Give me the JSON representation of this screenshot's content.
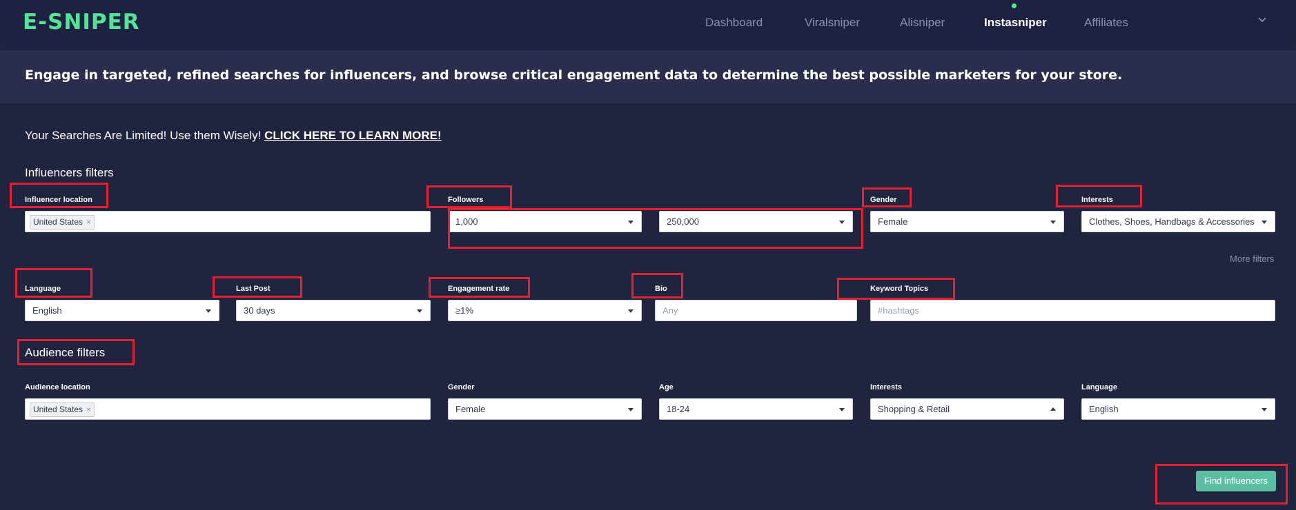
{
  "brand": {
    "logo": "E-SNIPER",
    "accent": "#55e39a"
  },
  "nav": {
    "items": [
      {
        "label": "Dashboard",
        "active": false
      },
      {
        "label": "Viralsniper",
        "active": false
      },
      {
        "label": "Alisniper",
        "active": false
      },
      {
        "label": "Instasniper",
        "active": true
      },
      {
        "label": "Affiliates",
        "active": false
      }
    ],
    "menu_icon": "chevron-down-icon"
  },
  "hero": {
    "text": "Engage in targeted, refined searches for influencers, and browse critical engagement data to determine the best possible marketers for your store."
  },
  "notice": {
    "text": "Your Searches Are Limited! Use them Wisely! ",
    "link": "CLICK HERE TO LEARN MORE!"
  },
  "influencer_filters": {
    "title": "Influencers filters",
    "location": {
      "label": "Influencer location",
      "tag": "United States",
      "remove": "×"
    },
    "followers": {
      "label": "Followers",
      "min": "1,000",
      "max": "250,000"
    },
    "gender": {
      "label": "Gender",
      "value": "Female"
    },
    "interests": {
      "label": "Interests",
      "value": "Clothes, Shoes, Handbags & Accessories"
    },
    "more_filters": "More filters",
    "language": {
      "label": "Language",
      "value": "English"
    },
    "last_post": {
      "label": "Last Post",
      "value": "30 days"
    },
    "engagement": {
      "label": "Engagement rate",
      "value": "≥1%"
    },
    "bio": {
      "label": "Bio",
      "placeholder": "Any"
    },
    "keywords": {
      "label": "Keyword Topics",
      "placeholder": "#hashtags"
    }
  },
  "audience_filters": {
    "title": "Audience filters",
    "location": {
      "label": "Audience location",
      "tag": "United States",
      "remove": "×"
    },
    "gender": {
      "label": "Gender",
      "value": "Female"
    },
    "age": {
      "label": "Age",
      "value": "18-24"
    },
    "interests": {
      "label": "Interests",
      "value": "Shopping & Retail"
    },
    "language": {
      "label": "Language",
      "value": "English"
    }
  },
  "actions": {
    "find": "Find influencers"
  },
  "colors": {
    "background": "#20243e",
    "highlight": "#e32230",
    "button": "#5cbfa3"
  }
}
